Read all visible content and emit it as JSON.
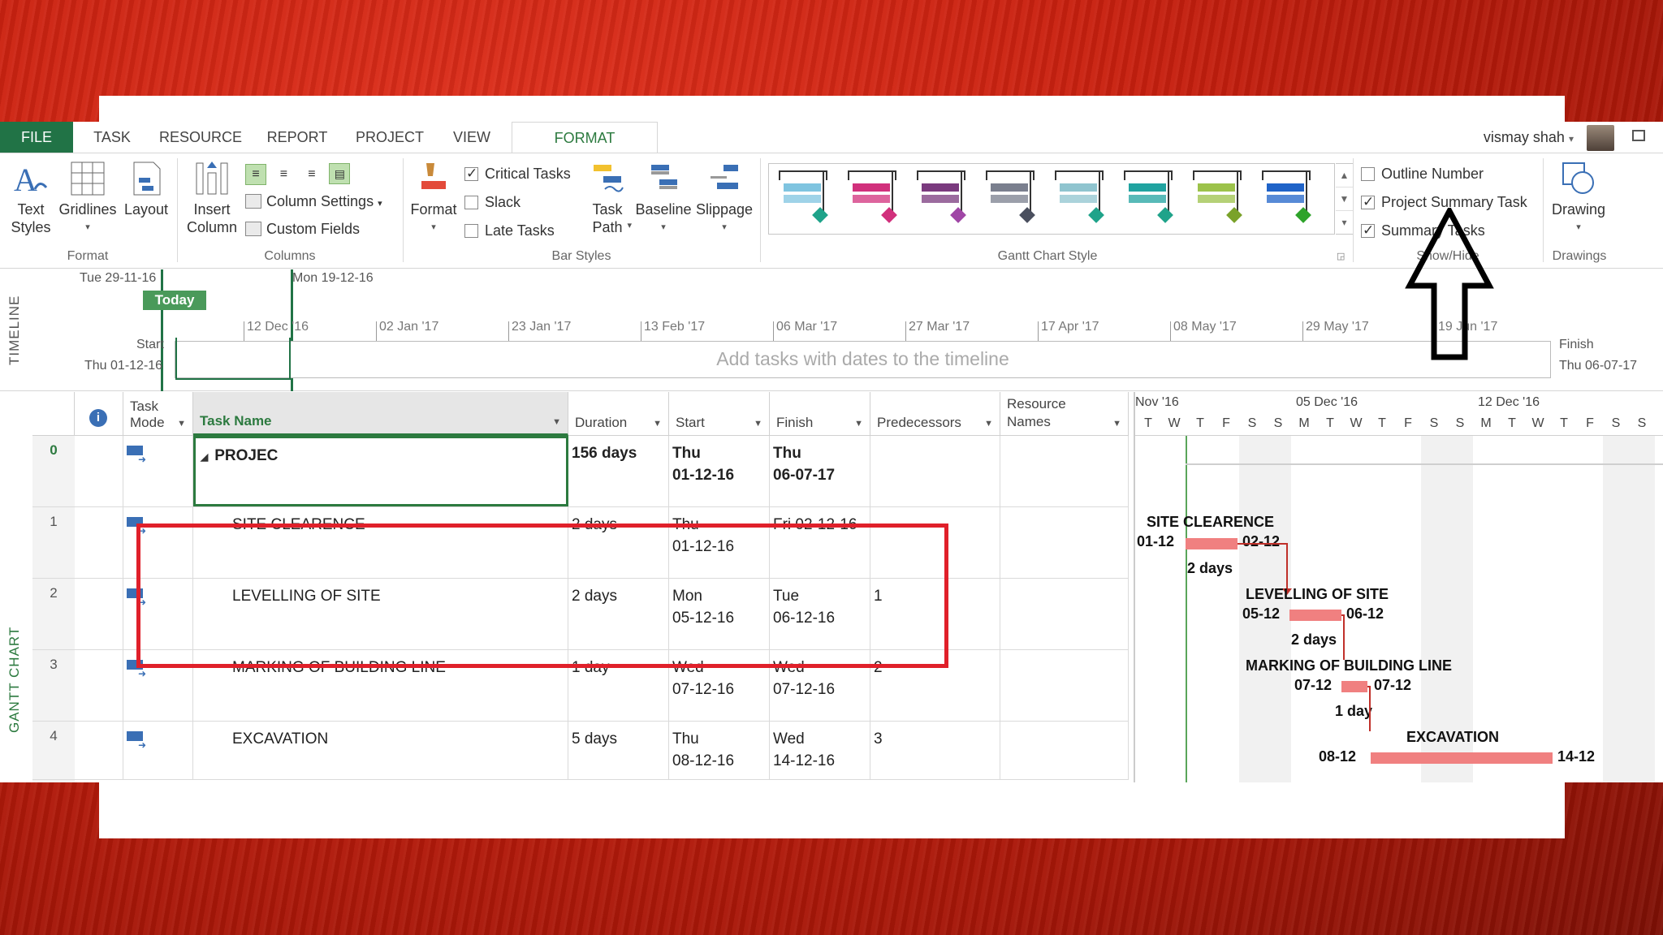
{
  "tabs": [
    "FILE",
    "TASK",
    "RESOURCE",
    "REPORT",
    "PROJECT",
    "VIEW",
    "FORMAT"
  ],
  "user": {
    "name": "vismay shah",
    "dropdown": "▾"
  },
  "ribbon": {
    "format": {
      "text_styles": "Text\nStyles",
      "gridlines": "Gridlines",
      "layout": "Layout",
      "label": "Format"
    },
    "columns": {
      "insert_column": "Insert\nColumn",
      "column_settings": "Column Settings",
      "custom_fields": "Custom Fields",
      "label": "Columns"
    },
    "bar_styles": {
      "format": "Format",
      "critical_tasks": "Critical Tasks",
      "critical_tasks_checked": true,
      "slack": "Slack",
      "slack_checked": false,
      "late_tasks": "Late Tasks",
      "late_tasks_checked": false,
      "task_path": "Task\nPath",
      "baseline": "Baseline",
      "slippage": "Slippage",
      "label": "Bar Styles"
    },
    "gantt_chart_style": {
      "label": "Gantt Chart Style",
      "styles": [
        {
          "color": "#7fc4e0",
          "accent": "#1fa38a"
        },
        {
          "color": "#d1307c",
          "accent": "#d1307c"
        },
        {
          "color": "#7a3a7e",
          "accent": "#a046a6"
        },
        {
          "color": "#7a7f8e",
          "accent": "#4a4f5e"
        },
        {
          "color": "#8fc4cf",
          "accent": "#1fa38a"
        },
        {
          "color": "#20a3a0",
          "accent": "#1fa38a"
        },
        {
          "color": "#9cc24a",
          "accent": "#7aa22a"
        },
        {
          "color": "#1f63c8",
          "accent": "#2ea32a"
        }
      ]
    },
    "show_hide": {
      "outline_number": "Outline Number",
      "outline_number_checked": false,
      "project_summary_task": "Project Summary Task",
      "project_summary_task_checked": true,
      "summary_tasks": "Summary Tasks",
      "summary_tasks_checked": true,
      "label": "Show/Hide"
    },
    "drawings": {
      "drawing": "Drawing",
      "label": "Drawings"
    }
  },
  "timeline": {
    "vlabel": "TIMELINE",
    "today_date": "Tue 29-11-16",
    "today_label": "Today",
    "marker_date": "Mon 19-12-16",
    "start_label": "Start",
    "start_date": "Thu 01-12-16",
    "finish_label": "Finish",
    "finish_date": "Thu 06-07-17",
    "placeholder": "Add tasks with dates to the timeline",
    "ticks": [
      "12 Dec '16",
      "02 Jan '17",
      "23 Jan '17",
      "13 Feb '17",
      "06 Mar '17",
      "27 Mar '17",
      "17 Apr '17",
      "08 May '17",
      "29 May '17",
      "19 Jun '17"
    ]
  },
  "grid": {
    "vlabel": "GANTT CHART",
    "headers": {
      "task_mode": "Task\nMode",
      "task_name": "Task Name",
      "duration": "Duration",
      "start": "Start",
      "finish": "Finish",
      "predecessors": "Predecessors",
      "resource_names": "Resource\nNames"
    },
    "rows": [
      {
        "id": "0",
        "name": "PROJEC",
        "duration": "156 days",
        "start": "Thu\n01-12-16",
        "finish": "Thu\n06-07-17",
        "pred": "",
        "summary": true
      },
      {
        "id": "1",
        "name": "SITE CLEARENCE",
        "duration": "2 days",
        "start": "Thu\n01-12-16",
        "finish": "Fri 02-12-16",
        "pred": ""
      },
      {
        "id": "2",
        "name": "LEVELLING OF SITE",
        "duration": "2 days",
        "start": "Mon\n05-12-16",
        "finish": "Tue\n06-12-16",
        "pred": "1"
      },
      {
        "id": "3",
        "name": "MARKING OF BUILDING LINE",
        "duration": "1 day",
        "start": "Wed\n07-12-16",
        "finish": "Wed\n07-12-16",
        "pred": "2"
      },
      {
        "id": "4",
        "name": "EXCAVATION",
        "duration": "5 days",
        "start": "Thu\n08-12-16",
        "finish": "Wed\n14-12-16",
        "pred": "3"
      }
    ]
  },
  "gantt": {
    "weeks": [
      "Nov '16",
      "05 Dec '16",
      "12 Dec '16"
    ],
    "days": [
      "T",
      "W",
      "T",
      "F",
      "S",
      "S",
      "M",
      "T",
      "W",
      "T",
      "F",
      "S",
      "S",
      "M",
      "T",
      "W",
      "T",
      "F",
      "S",
      "S"
    ],
    "bars": [
      {
        "name": "SITE CLEARENCE",
        "start_lbl": "01-12",
        "end_lbl": "02-12",
        "dur": "2 days"
      },
      {
        "name": "LEVELLING OF SITE",
        "start_lbl": "05-12",
        "end_lbl": "06-12",
        "dur": "2 days"
      },
      {
        "name": "MARKING OF BUILDING LINE",
        "start_lbl": "07-12",
        "end_lbl": "07-12",
        "dur": "1 day"
      },
      {
        "name": "EXCAVATION",
        "start_lbl": "08-12",
        "end_lbl": "14-12",
        "dur": ""
      }
    ]
  },
  "colors": {
    "file_tab": "#217346",
    "accent_green": "#2c7a3f",
    "highlight_box": "#e0202a",
    "bar": "#f08080"
  }
}
